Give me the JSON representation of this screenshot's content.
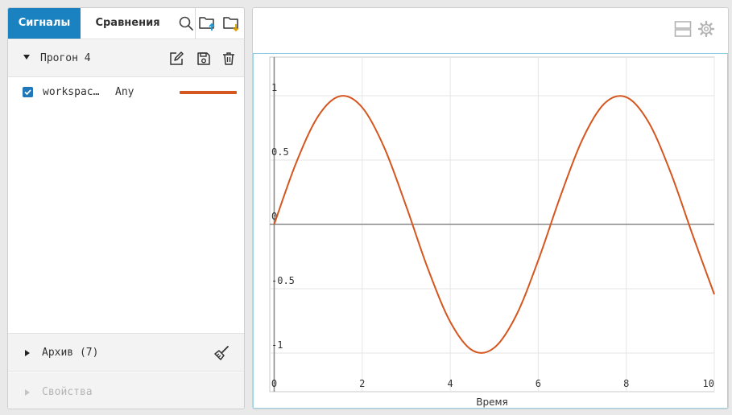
{
  "tabs": {
    "signals": "Сигналы",
    "compare": "Сравнения"
  },
  "toolbar_icons": [
    "search-icon",
    "folder-upload-icon",
    "folder-download-icon"
  ],
  "run": {
    "title": "Прогон 4",
    "signal": {
      "name": "workspac…",
      "type": "Any",
      "color": "#d5561e",
      "checked": true
    }
  },
  "archive": {
    "label": "Архив (7)"
  },
  "properties": {
    "label": "Свойства"
  },
  "plot_toolbar_icons": [
    "layout-icon",
    "gear-icon"
  ],
  "colors": {
    "accent": "#1b82c1",
    "series": "#d5561e",
    "disabled_text": "#b5b5b5"
  },
  "chart_data": {
    "type": "line",
    "xlabel": "Время",
    "ylabel": "",
    "xlim": [
      -0.1,
      10
    ],
    "ylim": [
      -1.3,
      1.3
    ],
    "x_ticks": [
      0,
      2,
      4,
      6,
      8,
      10
    ],
    "y_ticks": [
      1,
      0.5,
      0,
      -0.5,
      -1
    ],
    "x_tick_labels": [
      "0",
      "2",
      "4",
      "6",
      "8",
      "10"
    ],
    "y_tick_labels": [
      "1",
      "0.5",
      "0",
      "-0.5",
      "-1"
    ],
    "grid": true,
    "series": [
      {
        "name": "workspac…",
        "x": [
          0,
          0.5,
          1,
          1.5,
          2,
          2.5,
          3,
          3.5,
          4,
          4.5,
          5,
          5.5,
          6,
          6.5,
          7,
          7.5,
          8,
          8.5,
          9,
          9.5,
          10
        ],
        "y": [
          0,
          0.479,
          0.841,
          0.997,
          0.909,
          0.598,
          0.141,
          -0.351,
          -0.757,
          -0.978,
          -0.959,
          -0.706,
          -0.279,
          0.215,
          0.657,
          0.938,
          0.989,
          0.798,
          0.412,
          -0.075,
          -0.544
        ]
      }
    ]
  }
}
